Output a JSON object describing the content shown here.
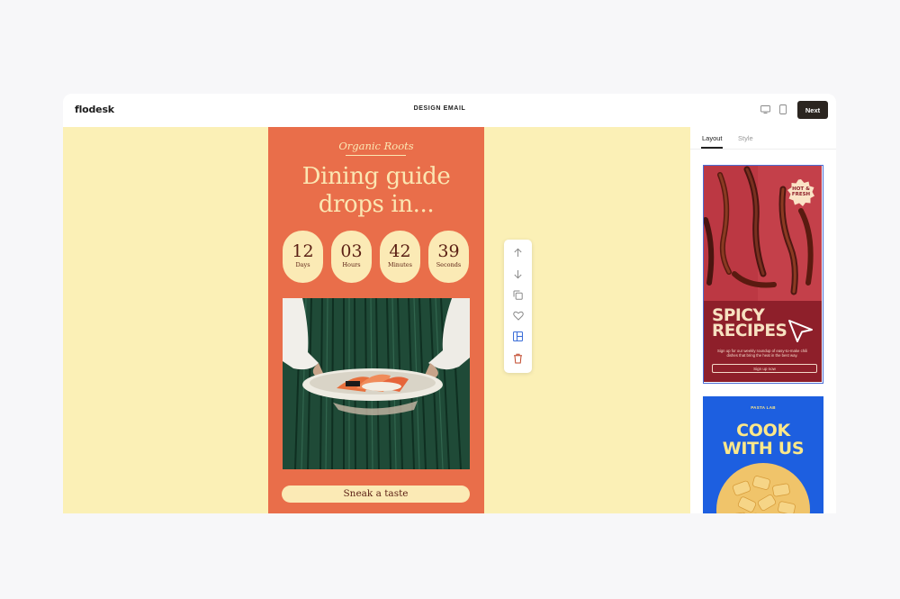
{
  "app": {
    "logo": "flodesk",
    "title": "DESIGN EMAIL",
    "next_label": "Next"
  },
  "email": {
    "brand": "Organic Roots",
    "headline_line1": "Dining guide",
    "headline_line2": "drops in...",
    "countdown": [
      {
        "value": "12",
        "label": "Days"
      },
      {
        "value": "03",
        "label": "Hours"
      },
      {
        "value": "42",
        "label": "Minutes"
      },
      {
        "value": "39",
        "label": "Seconds"
      }
    ],
    "cta_label": "Sneak a taste",
    "background_color": "#e96e4a",
    "canvas_color": "#fbf0b6"
  },
  "block_toolbar": {
    "actions": [
      "move-up-icon",
      "move-down-icon",
      "duplicate-icon",
      "favorite-icon",
      "layout-icon",
      "delete-icon"
    ]
  },
  "panel": {
    "tabs": [
      {
        "label": "Layout",
        "active": true
      },
      {
        "label": "Style",
        "active": false
      }
    ],
    "templates": [
      {
        "title_line1": "SPICY",
        "title_line2": "RECIPES",
        "badge_line1": "HOT &",
        "badge_line2": "FRESH",
        "body": "Sign up for our weekly roundup of easy-to-make chili dishes that bring the heat in the best way.",
        "button": "Sign up now",
        "selected": true
      },
      {
        "small_label": "PASTA LAB",
        "title_line1": "COOK",
        "title_line2": "WITH US",
        "selected": false
      }
    ]
  }
}
